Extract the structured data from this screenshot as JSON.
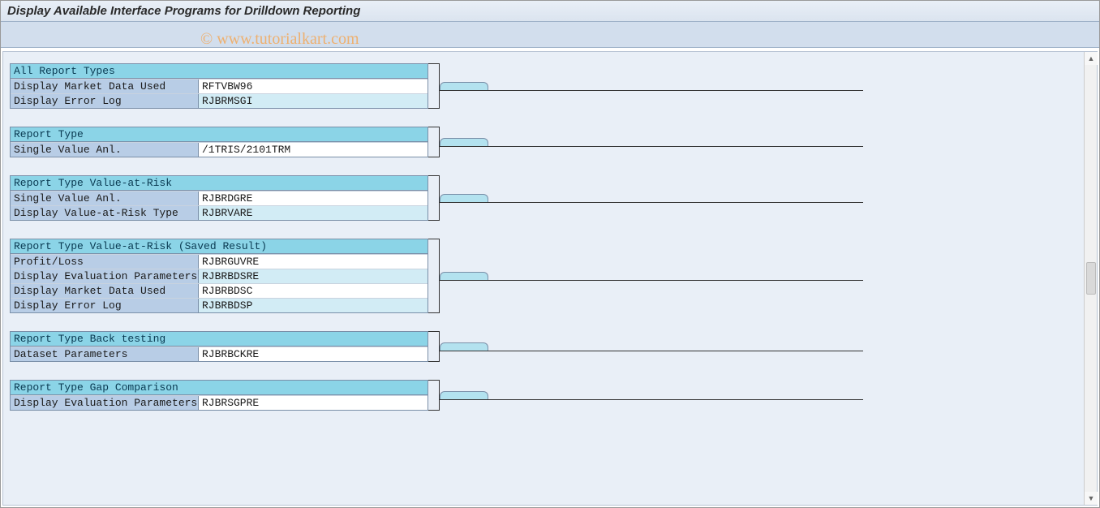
{
  "title": "Display Available Interface Programs for Drilldown Reporting",
  "watermark": "© www.tutorialkart.com",
  "groups": [
    {
      "header": "All Report Types",
      "rows": [
        {
          "label": "Display Market Data Used",
          "value": "RFTVBW96",
          "alt": false
        },
        {
          "label": "Display Error Log",
          "value": "RJBRMSGI",
          "alt": true
        }
      ]
    },
    {
      "header": "Report Type",
      "rows": [
        {
          "label": "Single Value Anl.",
          "value": "/1TRIS/2101TRM",
          "alt": false
        }
      ]
    },
    {
      "header": "Report Type Value-at-Risk",
      "rows": [
        {
          "label": "Single Value Anl.",
          "value": "RJBRDGRE",
          "alt": false
        },
        {
          "label": "Display Value-at-Risk Type",
          "value": "RJBRVARE",
          "alt": true
        }
      ]
    },
    {
      "header": "Report Type Value-at-Risk (Saved Result)",
      "rows": [
        {
          "label": "Profit/Loss",
          "value": "RJBRGUVRE",
          "alt": false
        },
        {
          "label": "Display Evaluation Parameters",
          "value": "RJBRBDSRE",
          "alt": true
        },
        {
          "label": "Display Market Data Used",
          "value": "RJBRBDSC",
          "alt": false
        },
        {
          "label": "Display Error Log",
          "value": "RJBRBDSP",
          "alt": true
        }
      ]
    },
    {
      "header": "Report Type Back testing",
      "rows": [
        {
          "label": "Dataset Parameters",
          "value": "RJBRBCKRE",
          "alt": false
        }
      ]
    },
    {
      "header": "Report Type Gap Comparison",
      "rows": [
        {
          "label": "Display Evaluation Parameters",
          "value": "RJBRSGPRE",
          "alt": false
        }
      ]
    }
  ]
}
